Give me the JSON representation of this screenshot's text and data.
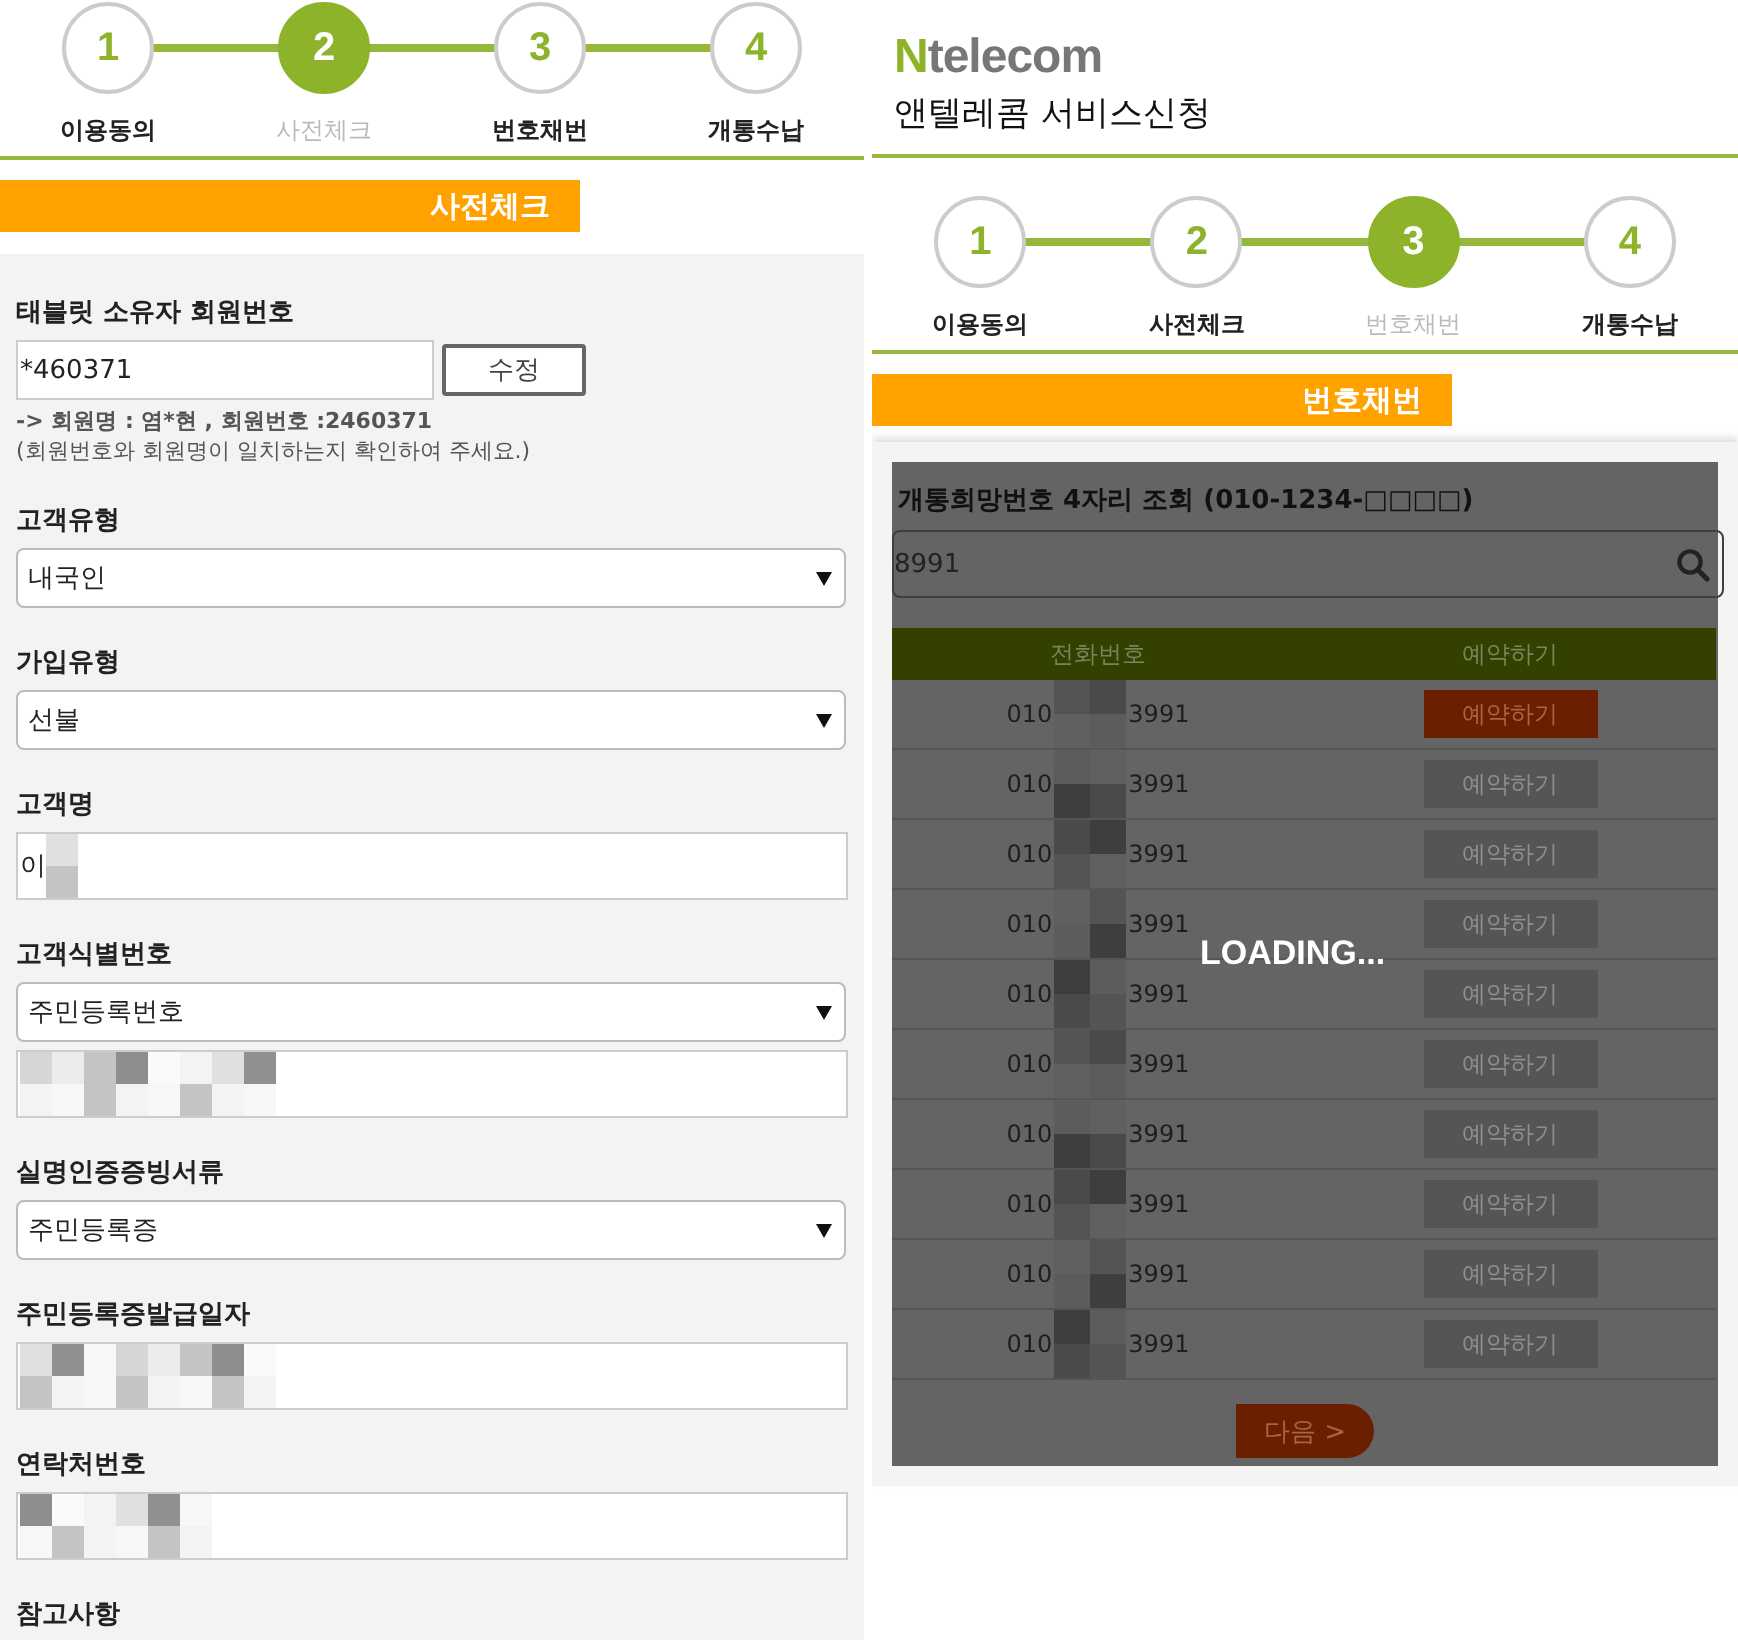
{
  "left": {
    "steps": [
      {
        "number": "1",
        "label": "이용동의",
        "selected": false
      },
      {
        "number": "2",
        "label": "사전체크",
        "selected": true
      },
      {
        "number": "3",
        "label": "번호채번",
        "selected": false
      },
      {
        "number": "4",
        "label": "개통수납",
        "selected": false
      }
    ],
    "section_title": "사전체크",
    "fields": [
      {
        "label": "태블릿 소유자 회원번호",
        "controls": [
          {
            "kind": "text_button",
            "value": "*460371",
            "button": "수정"
          }
        ],
        "notes": [
          "-> 회원명 : 염*현 , 회원번호 :2460371",
          "(회원번호와 회원명이 일치하는지 확인하여 주세요.)"
        ]
      },
      {
        "label": "고객유형",
        "controls": [
          {
            "kind": "select",
            "value": "내국인"
          }
        ]
      },
      {
        "label": "가입유형",
        "controls": [
          {
            "kind": "select",
            "value": "선불"
          }
        ]
      },
      {
        "label": "고객명",
        "controls": [
          {
            "kind": "masked",
            "value": "이"
          }
        ]
      },
      {
        "label": "고객식별번호",
        "controls": [
          {
            "kind": "select",
            "value": "주민등록번호"
          },
          {
            "kind": "masked"
          }
        ]
      },
      {
        "label": "실명인증증빙서류",
        "controls": [
          {
            "kind": "select",
            "value": "주민등록증"
          }
        ]
      },
      {
        "label": "주민등록증발급일자",
        "controls": [
          {
            "kind": "masked"
          }
        ]
      },
      {
        "label": "연락처번호",
        "controls": [
          {
            "kind": "masked"
          }
        ]
      },
      {
        "label": "참고사항"
      }
    ]
  },
  "right": {
    "logo": {
      "mark": "N",
      "text": "telecom"
    },
    "title": "앤텔레콤 서비스신청",
    "steps": [
      {
        "number": "1",
        "label": "이용동의",
        "selected": false
      },
      {
        "number": "2",
        "label": "사전체크",
        "selected": false
      },
      {
        "number": "3",
        "label": "번호채번",
        "selected": true
      },
      {
        "number": "4",
        "label": "개통수납",
        "selected": false
      }
    ],
    "section_title": "번호채번",
    "search": {
      "label": "개통희망번호 4자리 조회 (010-1234-□□□□)",
      "value": "8991"
    },
    "table": {
      "columns": [
        "전화번호",
        "예약하기"
      ],
      "rows": [
        {
          "prefix": "010",
          "suffix": "3991",
          "button": "예약하기",
          "selected": true
        },
        {
          "prefix": "010",
          "suffix": "3991",
          "button": "예약하기",
          "selected": false
        },
        {
          "prefix": "010",
          "suffix": "3991",
          "button": "예약하기",
          "selected": false
        },
        {
          "prefix": "010",
          "suffix": "3991",
          "button": "예약하기",
          "selected": false
        },
        {
          "prefix": "010",
          "suffix": "3991",
          "button": "예약하기",
          "selected": false
        },
        {
          "prefix": "010",
          "suffix": "3991",
          "button": "예약하기",
          "selected": false
        },
        {
          "prefix": "010",
          "suffix": "3991",
          "button": "예약하기",
          "selected": false
        },
        {
          "prefix": "010",
          "suffix": "3991",
          "button": "예약하기",
          "selected": false
        },
        {
          "prefix": "010",
          "suffix": "3991",
          "button": "예약하기",
          "selected": false
        },
        {
          "prefix": "010",
          "suffix": "3991",
          "button": "예약하기",
          "selected": false
        }
      ]
    },
    "next_button": "다음 >",
    "loading": "LOADING..."
  }
}
